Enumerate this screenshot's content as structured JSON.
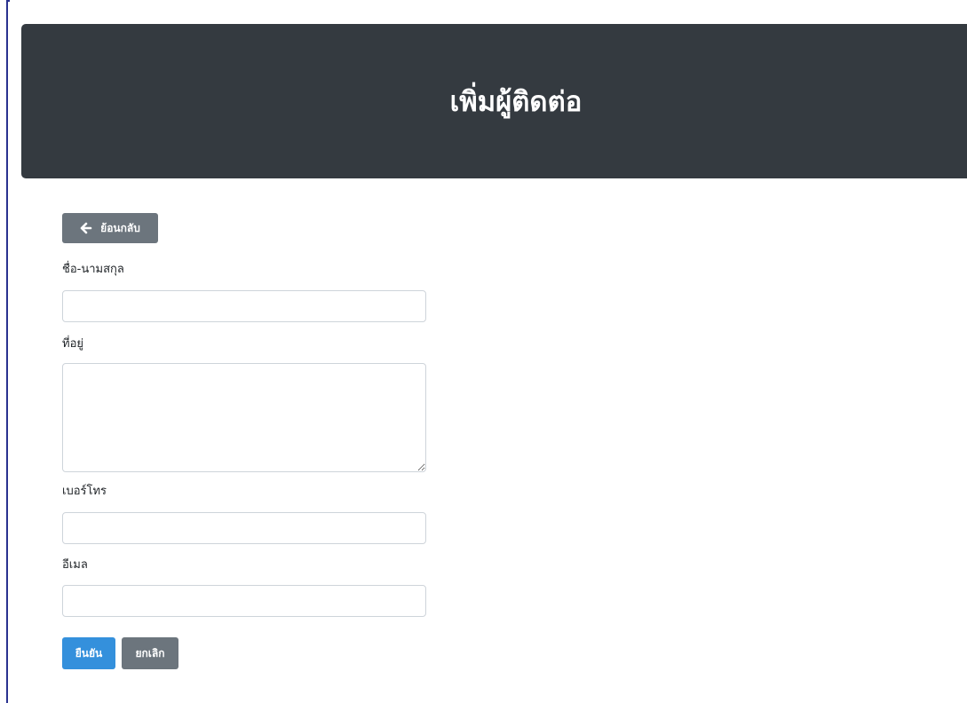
{
  "header": {
    "title": "เพิ่มผู้ติดต่อ"
  },
  "back_button": {
    "label": "ย้อนกลับ",
    "icon": "arrow-left-icon"
  },
  "form": {
    "name_label": "ชื่อ-นามสกุล",
    "name_value": "",
    "address_label": "ที่อยู่",
    "address_value": "",
    "phone_label": "เบอร์โทร",
    "phone_value": "",
    "email_label": "อีเมล",
    "email_value": ""
  },
  "actions": {
    "confirm_label": "ยืนยัน",
    "cancel_label": "ยกเลิก"
  },
  "colors": {
    "header_bg": "#343a40",
    "primary": "#3490dc",
    "secondary": "#6c757d"
  }
}
